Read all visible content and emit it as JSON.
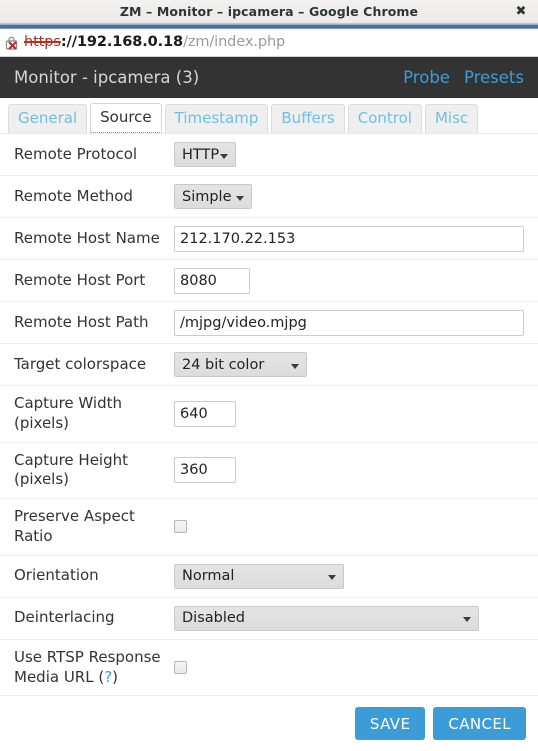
{
  "window": {
    "title": "ZM – Monitor – ipcamera – Google Chrome",
    "close_label": "✖"
  },
  "omnibox": {
    "scheme": "https",
    "separator": "://",
    "host": "192.168.0.18",
    "path": "/zm/index.php",
    "security_icon": "insecure-lock-icon"
  },
  "page_header": {
    "title": "Monitor - ipcamera (3)",
    "links": [
      {
        "label": "Probe"
      },
      {
        "label": "Presets"
      }
    ]
  },
  "tabs": [
    {
      "label": "General",
      "active": false
    },
    {
      "label": "Source",
      "active": true
    },
    {
      "label": "Timestamp",
      "active": false
    },
    {
      "label": "Buffers",
      "active": false
    },
    {
      "label": "Control",
      "active": false
    },
    {
      "label": "Misc",
      "active": false
    }
  ],
  "form": {
    "remote_protocol": {
      "label": "Remote Protocol",
      "value": "HTTP"
    },
    "remote_method": {
      "label": "Remote Method",
      "value": "Simple"
    },
    "remote_host_name": {
      "label": "Remote Host Name",
      "value": "212.170.22.153"
    },
    "remote_host_port": {
      "label": "Remote Host Port",
      "value": "8080"
    },
    "remote_host_path": {
      "label": "Remote Host Path",
      "value": "/mjpg/video.mjpg"
    },
    "target_colorspace": {
      "label": "Target colorspace",
      "value": "24 bit color"
    },
    "capture_width": {
      "label": "Capture Width (pixels)",
      "value": "640"
    },
    "capture_height": {
      "label": "Capture Height (pixels)",
      "value": "360"
    },
    "preserve_aspect_ratio": {
      "label": "Preserve Aspect Ratio",
      "checked": false
    },
    "orientation": {
      "label": "Orientation",
      "value": "Normal"
    },
    "deinterlacing": {
      "label": "Deinterlacing",
      "value": "Disabled"
    },
    "use_rtsp_media_url": {
      "label_prefix": "Use RTSP Response Media URL (",
      "help_label": "?",
      "label_suffix": ")",
      "checked": false
    }
  },
  "buttons": {
    "save": "SAVE",
    "cancel": "CANCEL"
  },
  "colors": {
    "accent_blue": "#3c9cd7",
    "header_dark": "#333333",
    "link_blue": "#6bc0e8",
    "insecure_red": "#b03027"
  }
}
